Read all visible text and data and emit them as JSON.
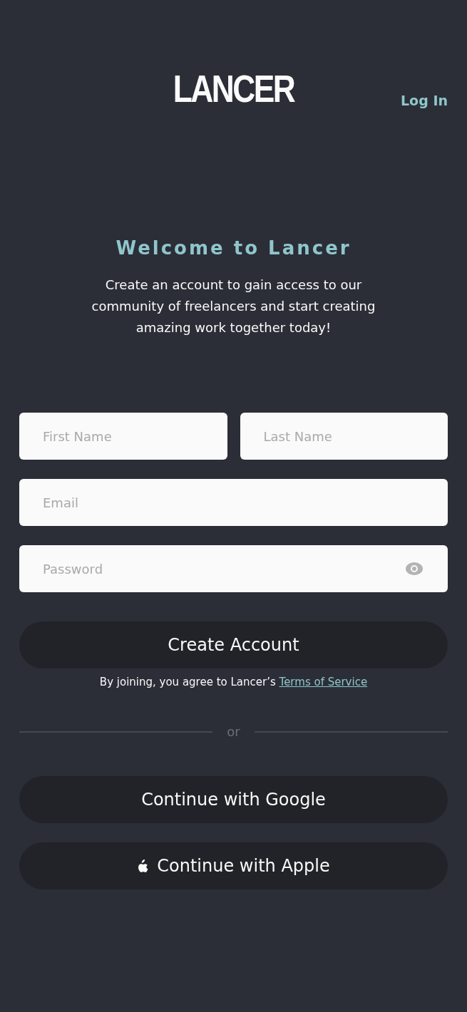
{
  "header": {
    "logo": "LANCER",
    "login_link": "Log In"
  },
  "welcome": {
    "title": "Welcome to Lancer",
    "text": "Create an account to gain access to our community of freelancers and start creating amazing work together today!"
  },
  "form": {
    "name_fields": [
      {
        "placeholder": "First Name"
      },
      {
        "placeholder": "Last Name"
      }
    ],
    "email": {
      "placeholder": "Email"
    },
    "password": {
      "placeholder": "Password",
      "show_toggle": true
    },
    "submit": "Create Account",
    "terms": {
      "text": "By joining, you agree to Lancer’s",
      "link": "Terms of Service"
    }
  },
  "divider": "or",
  "social_buttons": [
    {
      "kind": "google",
      "label": "Continue with Google"
    },
    {
      "kind": "apple",
      "label": "Continue with Apple"
    }
  ]
}
